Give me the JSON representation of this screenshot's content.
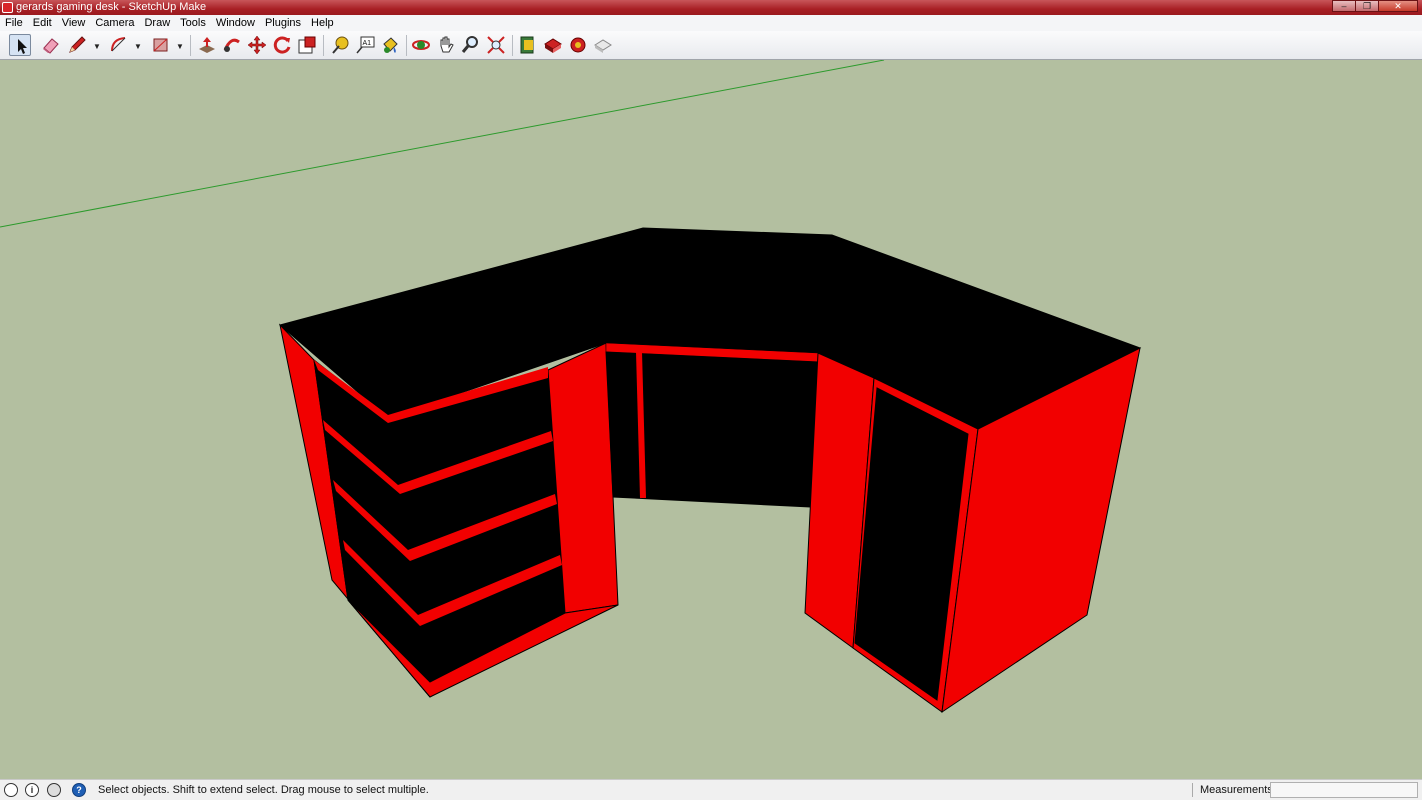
{
  "window": {
    "title": "gerards gaming desk - SketchUp Make",
    "minimize": "–",
    "restore": "❐",
    "close": "✕"
  },
  "menu": [
    "File",
    "Edit",
    "View",
    "Camera",
    "Draw",
    "Tools",
    "Window",
    "Plugins",
    "Help"
  ],
  "toolbar": {
    "tools": [
      "select-tool",
      "eraser-tool",
      "pencil-tool",
      "arc-tool",
      "rectangle-tool",
      "push-pull-tool",
      "follow-me-tool",
      "move-tool",
      "rotate-tool",
      "scale-tool",
      "tape-measure-tool",
      "text-tool",
      "paint-bucket-tool",
      "orbit-tool",
      "pan-tool",
      "zoom-tool",
      "zoom-extents-tool",
      "3d-warehouse-icon",
      "share-model-icon",
      "extension-warehouse-icon",
      "layout-icon"
    ],
    "selected": "select-tool",
    "text_tool_label": "A1"
  },
  "model": {
    "name": "gerards gaming desk",
    "colors": {
      "body": "#f20000",
      "panel": "#000000",
      "background": "#b3bfa0",
      "green_axis": "#2c9a2c"
    }
  },
  "status": {
    "message": "Select objects. Shift to extend select. Drag mouse to select multiple.",
    "icons": [
      "geo-location-icon",
      "credits-icon",
      "user-icon",
      "help-icon"
    ],
    "credits_glyph": "i",
    "help_glyph": "?",
    "measurements_label": "Measurements",
    "measurements_value": ""
  }
}
